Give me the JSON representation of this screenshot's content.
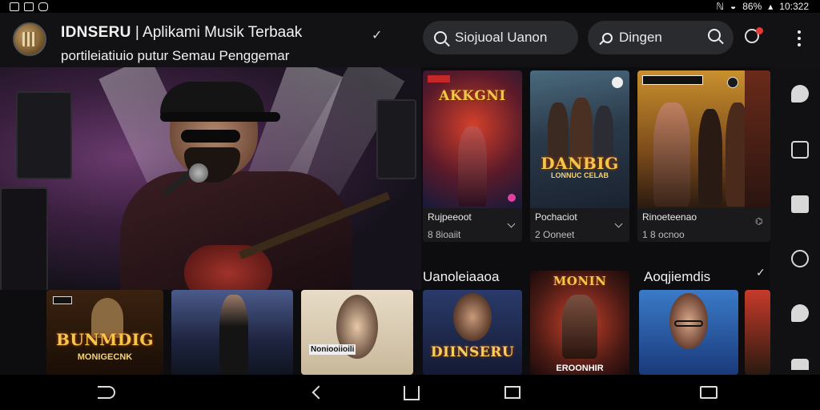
{
  "status_bar": {
    "battery": "86%",
    "time": "10:322"
  },
  "header": {
    "app_name": "IDNSERU",
    "title_rest": "| Aplikami Musik Terbaak",
    "subtitle": "portileiatiuio putur Semau Penggemar",
    "search_placeholder": "Siojuoal Uanon",
    "genre_label": "Dingen"
  },
  "top_cards": [
    {
      "tag": "",
      "poster_title": "AKKGNI",
      "poster_sub": "",
      "title": "Rujpeeoot",
      "sub": "8 8ioaiit"
    },
    {
      "tag": "",
      "poster_title": "DANBIG",
      "poster_sub": "LONNUC CELAB",
      "title": "Pochaciot",
      "sub": "2 Ooneet"
    },
    {
      "tag": "",
      "poster_title": "",
      "poster_sub": "",
      "title": "Rinoeteenao",
      "sub": "1 8 ocnoo"
    }
  ],
  "row_headers": {
    "left": "Uanoleiaaoa",
    "right": "Aoqjiemdis"
  },
  "bottom_cards": [
    {
      "poster_title": "BUNMDIG",
      "poster_sub": "MONIGECNK"
    },
    {
      "poster_title": "",
      "poster_sub": ""
    },
    {
      "poster_title": "",
      "poster_sub": "Noniooiioili"
    },
    {
      "poster_title": "DIINSERU",
      "poster_sub": ""
    },
    {
      "poster_title": "MONIN",
      "poster_sub": "EROONHIR"
    },
    {
      "poster_title": "",
      "poster_sub": ""
    }
  ],
  "colors": {
    "background": "#0d0d0f",
    "accent_red": "#e53935",
    "poster_gold": "#f3c74b"
  }
}
